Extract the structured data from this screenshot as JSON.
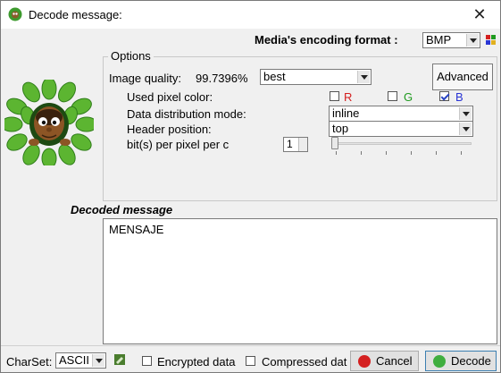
{
  "window": {
    "title": "Decode message:",
    "close_glyph": "✕"
  },
  "header": {
    "format_label": "Media's encoding format :",
    "format_value": "BMP",
    "format_icon": "palette-icon"
  },
  "options": {
    "group_title": "Options",
    "image_quality_label": "Image quality:",
    "image_quality_value": "99.7396%",
    "quality_select": "best",
    "advanced_button": "Advanced",
    "pixel_color_label": "Used pixel color:",
    "colors": [
      {
        "label": "R",
        "checked": false,
        "color": "#d42020"
      },
      {
        "label": "G",
        "checked": false,
        "color": "#1f9a1f"
      },
      {
        "label": "B",
        "checked": true,
        "color": "#2a35d4"
      }
    ],
    "distribution_label": "Data distribution mode:",
    "distribution_value": "inline",
    "header_position_label": "Header position:",
    "header_position_value": "top",
    "bits_label": "bit(s) per pixel per c",
    "bits_value": "1",
    "bits_slider_level": 0
  },
  "decoded": {
    "label": "Decoded message",
    "text": "MENSAJE"
  },
  "footer": {
    "charset_label": "CharSet:",
    "charset_value": "ASCII",
    "encrypted_label": "Encrypted data",
    "compressed_label": "Compressed dat",
    "cancel_button": "Cancel",
    "decode_button": "Decode"
  },
  "colors": {
    "window_bg": "#f0f0f0",
    "cancel_icon": "#d42020",
    "decode_icon": "#3fae3f"
  }
}
